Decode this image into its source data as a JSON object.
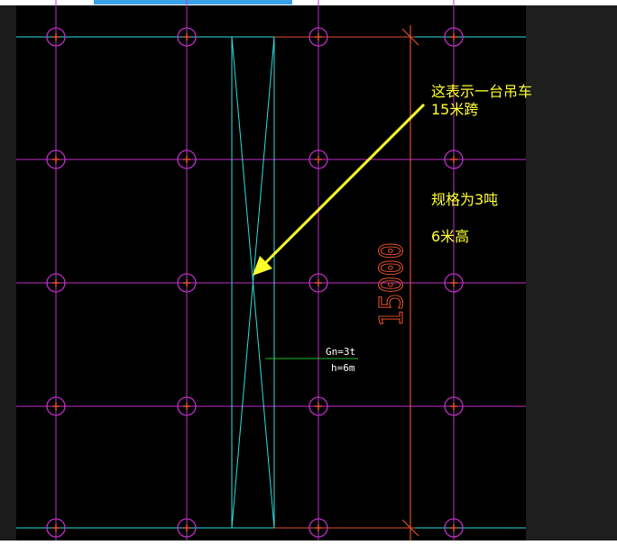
{
  "theme": {
    "page_bg": "#ffffff",
    "left_margin_bg": "#1b1b1b",
    "right_panel_bg": "#1e1e1e",
    "canvas_bg": "#000000",
    "top_bar": "#3aa0e8",
    "grid_color": "#c030c8",
    "column_circle_color": "#c030c8",
    "column_mark_color": "#e0502a",
    "crane_color": "#2de0e0",
    "dimension_color": "#e0502a",
    "arrow_color": "#ffff2a",
    "annotation_text_color": "#ffff30",
    "label_text_color": "#ffffff",
    "leader_line_color": "#20c020"
  },
  "annotation": {
    "line1": "这表示一台吊车",
    "line2": "15米跨",
    "spec": "规格为3吨",
    "height": "6米高"
  },
  "crane_label": {
    "capacity": "Gn=3t",
    "height": "h=6m"
  },
  "dimension": {
    "value": "15000"
  }
}
